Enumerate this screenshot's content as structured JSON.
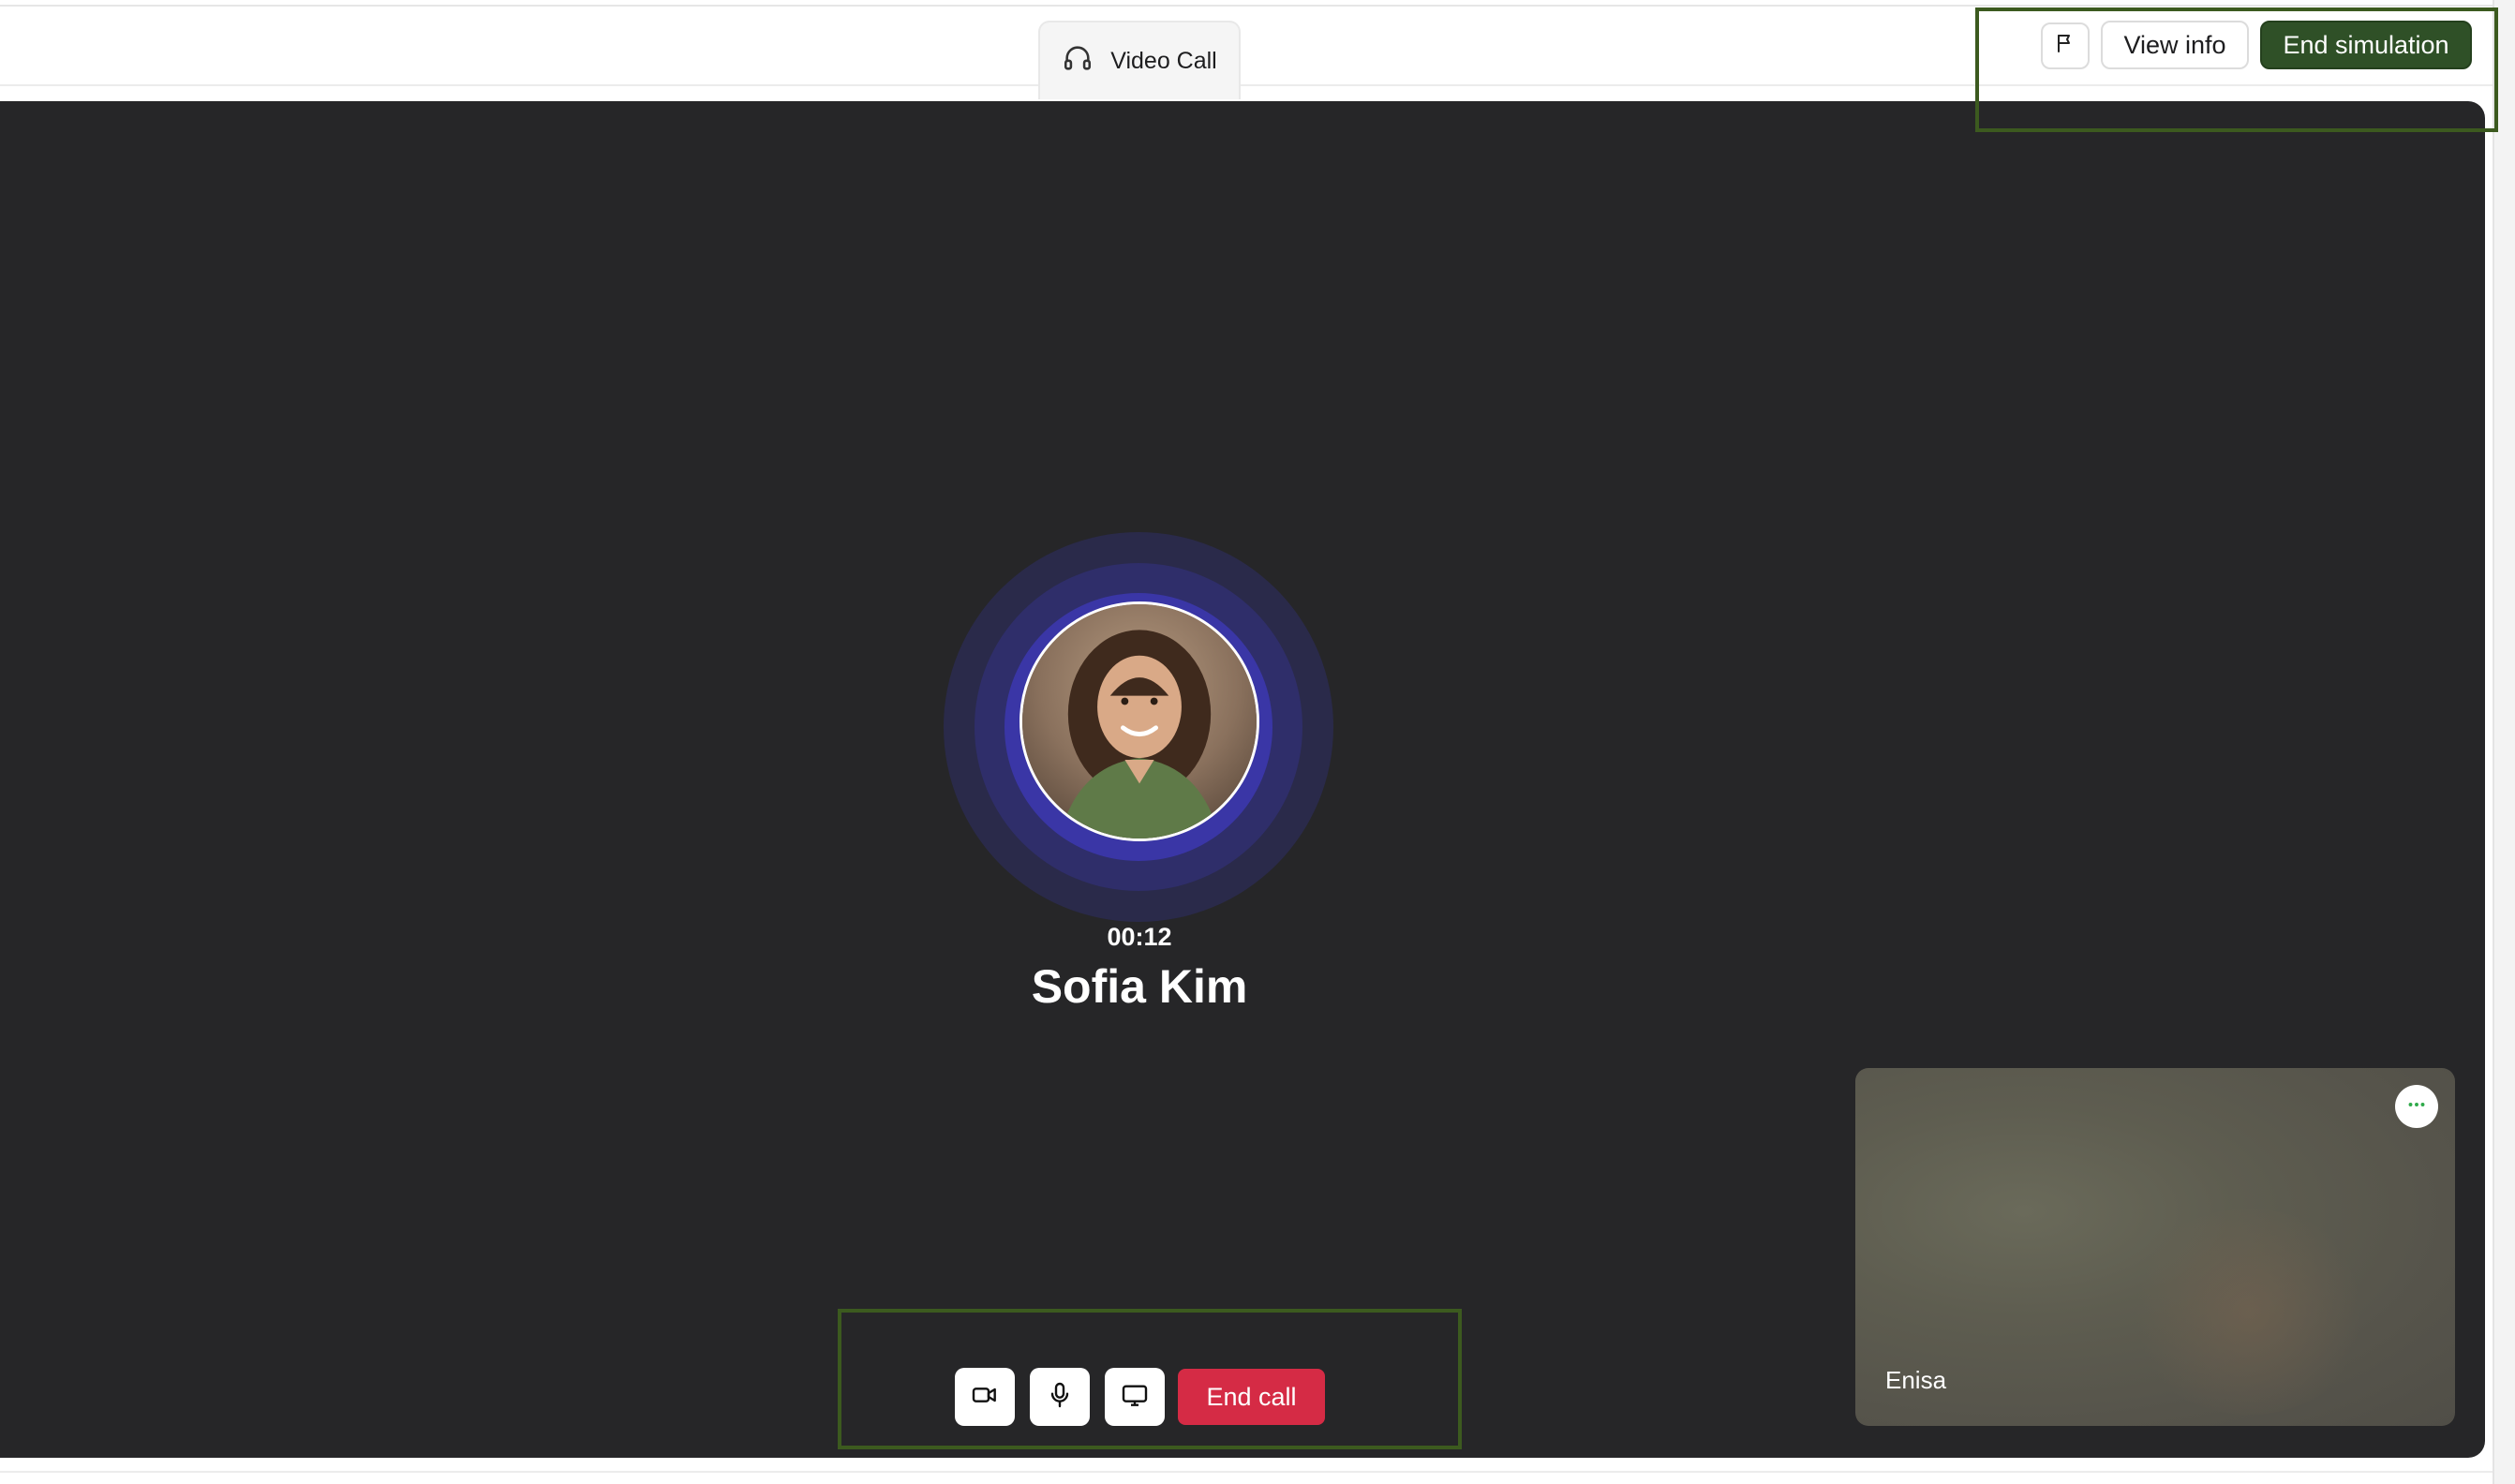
{
  "header": {
    "tab_label": "Video Call",
    "tab_icon": "headset-icon",
    "flag_icon": "flag-icon",
    "view_info_label": "View info",
    "end_simulation_label": "End simulation"
  },
  "call": {
    "timer": "00:12",
    "caller_name": "Sofia Kim",
    "avatar_icon": "caller-avatar"
  },
  "self_view": {
    "name": "Enisa",
    "more_icon": "more-options-icon"
  },
  "controls": {
    "video_icon": "video-camera-icon",
    "mic_icon": "microphone-icon",
    "screen_icon": "screen-share-icon",
    "end_call_label": "End call"
  },
  "colors": {
    "stage_bg": "#262628",
    "end_simulation_bg": "#2f5027",
    "end_call_bg": "#d52b45",
    "ring_accent": "#3a36a6",
    "highlight": "#3c5a1f",
    "more_dots": "#2faa4a"
  }
}
